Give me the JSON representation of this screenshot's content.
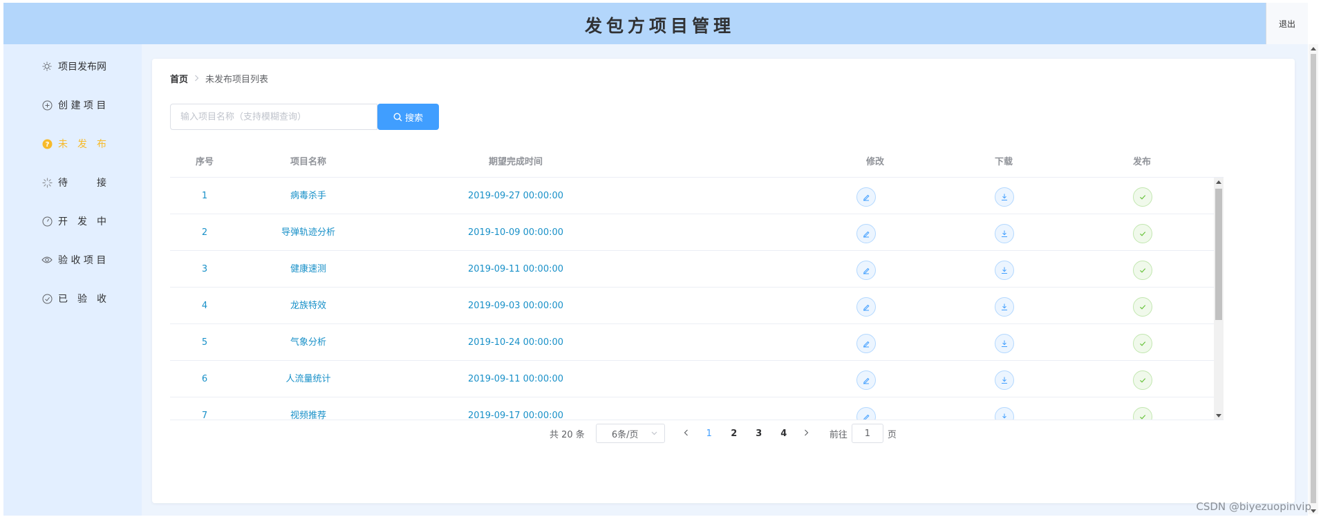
{
  "header": {
    "title": "发包方项目管理",
    "logout_label": "退出"
  },
  "sidebar": {
    "items": [
      {
        "label": "项目发布网",
        "icon": "sun-icon"
      },
      {
        "label": "创 建 项 目",
        "icon": "circle-plus-icon"
      },
      {
        "label": "未　发　布",
        "icon": "question-circle-icon",
        "active": true
      },
      {
        "label": "待　　　接",
        "icon": "loading-icon"
      },
      {
        "label": "开　发　中",
        "icon": "timer-icon"
      },
      {
        "label": "验 收 项 目",
        "icon": "eye-icon"
      },
      {
        "label": "已　验　收",
        "icon": "circle-check-icon"
      }
    ],
    "active_color": "#f7ba2a"
  },
  "breadcrumb": {
    "home": "首页",
    "separator": ">",
    "current": "未发布项目列表"
  },
  "search": {
    "placeholder": "输入项目名称（支持模糊查询）",
    "value": "",
    "button_label": "搜索",
    "button_color": "#409eff"
  },
  "table": {
    "columns": [
      "序号",
      "项目名称",
      "期望完成时间",
      "修改",
      "下载",
      "发布"
    ],
    "rows": [
      {
        "index": "1",
        "name": "病毒杀手",
        "due": "2019-09-27 00:00:00"
      },
      {
        "index": "2",
        "name": "导弹轨迹分析",
        "due": "2019-10-09 00:00:00"
      },
      {
        "index": "3",
        "name": "健康速测",
        "due": "2019-09-11 00:00:00"
      },
      {
        "index": "4",
        "name": "龙族特效",
        "due": "2019-09-03 00:00:00"
      },
      {
        "index": "5",
        "name": "气象分析",
        "due": "2019-10-24 00:00:00"
      },
      {
        "index": "6",
        "name": "人流量统计",
        "due": "2019-09-11 00:00:00"
      },
      {
        "index": "7",
        "name": "视频推荐",
        "due": "2019-09-17 00:00:00"
      }
    ],
    "row_text_color": "#1890c8",
    "action_icons": [
      "edit-icon",
      "download-icon",
      "check-icon"
    ]
  },
  "pagination": {
    "total_label": "共 20 条",
    "page_size_label": "6条/页",
    "pages": [
      "1",
      "2",
      "3",
      "4"
    ],
    "current_page": "1",
    "goto_prefix": "前往",
    "goto_value": "1",
    "goto_suffix": "页"
  },
  "watermark": "CSDN @biyezuopinvip"
}
